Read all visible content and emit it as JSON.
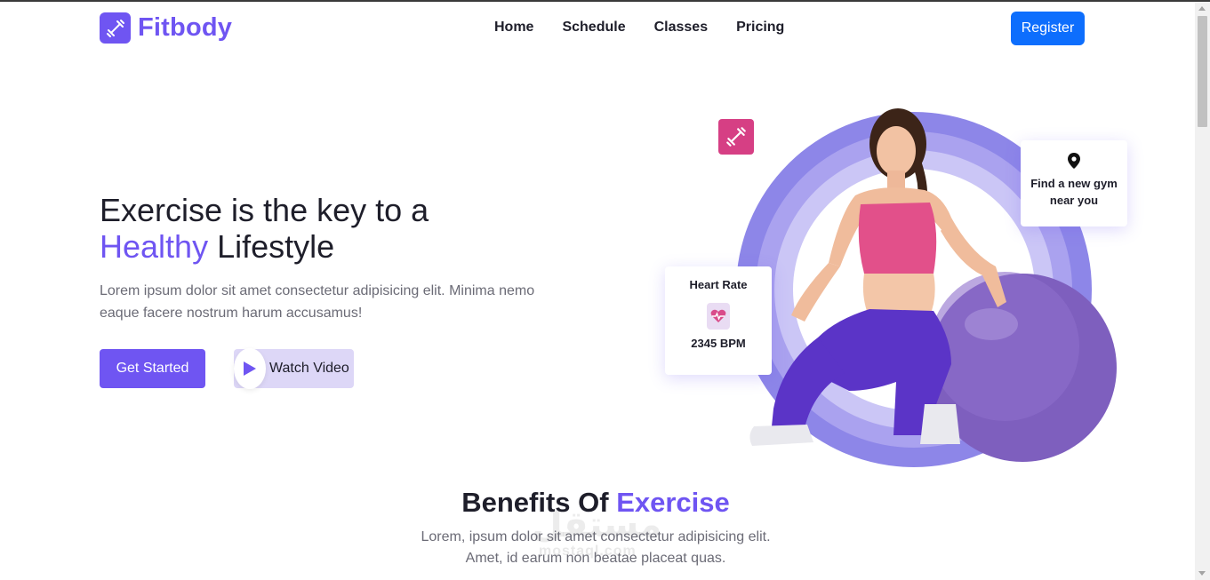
{
  "brand": {
    "name": "Fitbody",
    "accent_color": "#6f55f2",
    "icon": "dumbbell-icon"
  },
  "nav": {
    "items": [
      "Home",
      "Schedule",
      "Classes",
      "Pricing"
    ],
    "register_label": "Register"
  },
  "hero": {
    "title_line1": "Exercise is the key to a",
    "title_accent": "Healthy",
    "title_rest": " Lifestyle",
    "description": "Lorem ipsum dolor sit amet consectetur adipisicing elit. Minima nemo eaque facere nostrum harum accusamus!",
    "get_started_label": "Get Started",
    "watch_video_label": "Watch Video"
  },
  "cards": {
    "gym_line1": "Find a new gym",
    "gym_line2": "near you",
    "heart_title": "Heart Rate",
    "heart_value": "2345 BPM"
  },
  "benefits": {
    "title_main": "Benefits Of ",
    "title_accent": "Exercise",
    "desc_line1": "Lorem, ipsum dolor sit amet consectetur adipisicing elit.",
    "desc_line2": "Amet, id earum non beatae placeat quas."
  },
  "watermark": {
    "text": "مستقل",
    "subtext": "mostaql.com"
  }
}
